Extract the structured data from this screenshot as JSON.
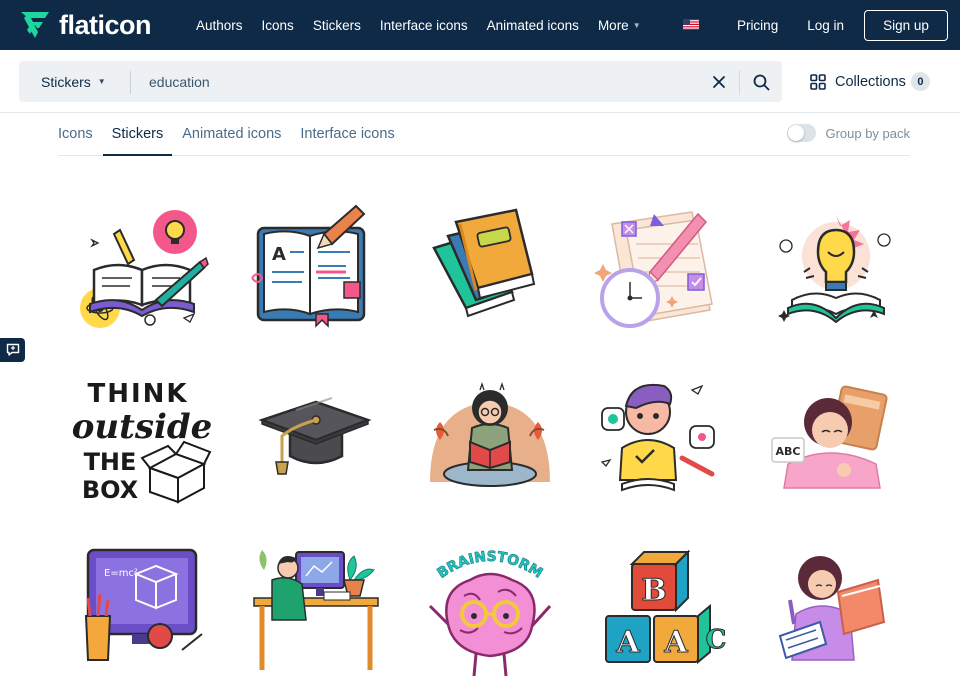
{
  "brand": {
    "name": "flaticon",
    "logo_icon": "flaticon-logo-icon",
    "accent": "#1fd6a1"
  },
  "nav": {
    "links": [
      "Authors",
      "Icons",
      "Stickers",
      "Interface icons",
      "Animated icons"
    ],
    "more_label": "More",
    "locale_icon": "us-flag-icon",
    "pricing_label": "Pricing",
    "login_label": "Log in",
    "signup_label": "Sign up"
  },
  "search": {
    "type_label": "Stickers",
    "query": "education",
    "collections_label": "Collections",
    "collections_count": "0"
  },
  "tabs": {
    "items": [
      "Icons",
      "Stickers",
      "Animated icons",
      "Interface icons"
    ],
    "active": "Stickers",
    "group_by_pack_label": "Group by pack",
    "group_by_pack_on": false
  },
  "stickers": [
    {
      "name": "open-book-ideas-sticker"
    },
    {
      "name": "notebook-pencil-sticker"
    },
    {
      "name": "stacked-books-sticker"
    },
    {
      "name": "clock-pencil-paper-sticker"
    },
    {
      "name": "lightbulb-book-sticker"
    },
    {
      "name": "think-outside-the-box-sticker",
      "text": [
        "THINK",
        "outside",
        "THE",
        "BOX"
      ]
    },
    {
      "name": "graduation-cap-sticker"
    },
    {
      "name": "girl-reading-sticker"
    },
    {
      "name": "boy-studying-sticker"
    },
    {
      "name": "girl-writing-abc-sticker",
      "text": [
        "ABC"
      ]
    },
    {
      "name": "computer-formula-sticker",
      "text": [
        "E=mc²"
      ]
    },
    {
      "name": "student-at-desk-sticker"
    },
    {
      "name": "brainstorm-brain-sticker",
      "text": [
        "BRAINSTORM"
      ]
    },
    {
      "name": "abc-blocks-sticker",
      "text": [
        "B",
        "A",
        "A",
        "C"
      ]
    },
    {
      "name": "girl-with-books-sticker"
    }
  ],
  "colors": {
    "nav_bg": "#0e2a47",
    "search_bg": "#eef1f4",
    "text_muted": "#4a6b8a"
  }
}
